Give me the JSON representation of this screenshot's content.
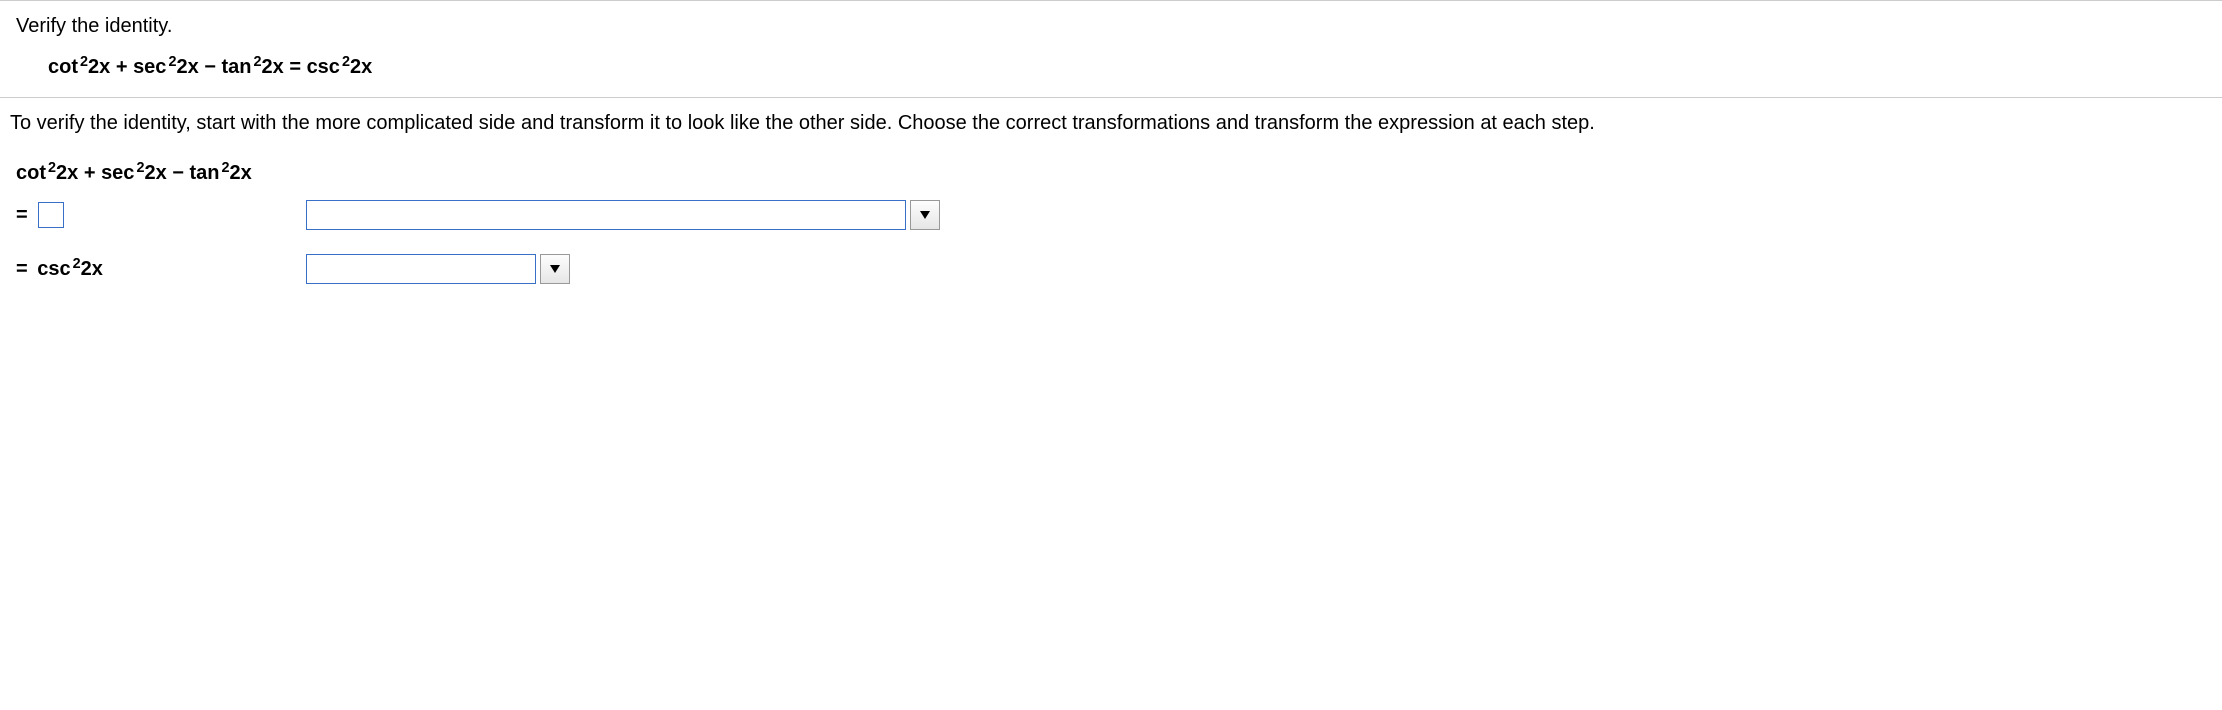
{
  "question": {
    "prompt": "Verify the identity.",
    "identity_terms": {
      "t1_fn": "cot",
      "t1_exp": "2",
      "t1_arg": "2x",
      "t2_op": " + ",
      "t2_fn": "sec",
      "t2_exp": "2",
      "t2_arg": "2x",
      "t3_op": " − ",
      "t3_fn": "tan",
      "t3_exp": "2",
      "t3_arg": "2x",
      "eq": " = ",
      "t4_fn": "csc",
      "t4_exp": "2",
      "t4_arg": "2x"
    }
  },
  "instruction": "To verify the identity, start with the more complicated side and transform it to look like the other side. Choose the correct transformations and transform the expression at each step.",
  "work": {
    "line1_terms": {
      "t1_fn": "cot",
      "t1_exp": "2",
      "t1_arg": "2x",
      "t2_op": " + ",
      "t2_fn": "sec",
      "t2_exp": "2",
      "t2_arg": "2x",
      "t3_op": " − ",
      "t3_fn": "tan",
      "t3_exp": "2",
      "t3_arg": "2x"
    },
    "line2_eq": "=",
    "line2_input_value": "",
    "line2_dropdown_value": "",
    "line3_eq": "= ",
    "line3_terms": {
      "fn": "csc",
      "exp": "2",
      "arg": "2x"
    },
    "line3_dropdown_value": ""
  }
}
